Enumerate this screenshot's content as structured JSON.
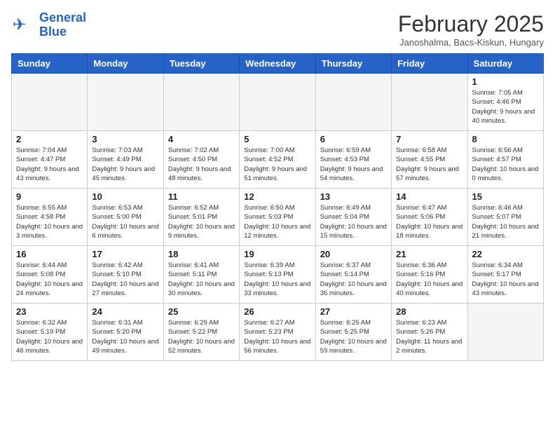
{
  "header": {
    "logo_line1": "General",
    "logo_line2": "Blue",
    "month": "February 2025",
    "location": "Janoshalma, Bacs-Kiskun, Hungary"
  },
  "weekdays": [
    "Sunday",
    "Monday",
    "Tuesday",
    "Wednesday",
    "Thursday",
    "Friday",
    "Saturday"
  ],
  "weeks": [
    [
      {
        "day": "",
        "info": ""
      },
      {
        "day": "",
        "info": ""
      },
      {
        "day": "",
        "info": ""
      },
      {
        "day": "",
        "info": ""
      },
      {
        "day": "",
        "info": ""
      },
      {
        "day": "",
        "info": ""
      },
      {
        "day": "1",
        "info": "Sunrise: 7:05 AM\nSunset: 4:46 PM\nDaylight: 9 hours and 40 minutes."
      }
    ],
    [
      {
        "day": "2",
        "info": "Sunrise: 7:04 AM\nSunset: 4:47 PM\nDaylight: 9 hours and 43 minutes."
      },
      {
        "day": "3",
        "info": "Sunrise: 7:03 AM\nSunset: 4:49 PM\nDaylight: 9 hours and 45 minutes."
      },
      {
        "day": "4",
        "info": "Sunrise: 7:02 AM\nSunset: 4:50 PM\nDaylight: 9 hours and 48 minutes."
      },
      {
        "day": "5",
        "info": "Sunrise: 7:00 AM\nSunset: 4:52 PM\nDaylight: 9 hours and 51 minutes."
      },
      {
        "day": "6",
        "info": "Sunrise: 6:59 AM\nSunset: 4:53 PM\nDaylight: 9 hours and 54 minutes."
      },
      {
        "day": "7",
        "info": "Sunrise: 6:58 AM\nSunset: 4:55 PM\nDaylight: 9 hours and 57 minutes."
      },
      {
        "day": "8",
        "info": "Sunrise: 6:56 AM\nSunset: 4:57 PM\nDaylight: 10 hours and 0 minutes."
      }
    ],
    [
      {
        "day": "9",
        "info": "Sunrise: 6:55 AM\nSunset: 4:58 PM\nDaylight: 10 hours and 3 minutes."
      },
      {
        "day": "10",
        "info": "Sunrise: 6:53 AM\nSunset: 5:00 PM\nDaylight: 10 hours and 6 minutes."
      },
      {
        "day": "11",
        "info": "Sunrise: 6:52 AM\nSunset: 5:01 PM\nDaylight: 10 hours and 9 minutes."
      },
      {
        "day": "12",
        "info": "Sunrise: 6:50 AM\nSunset: 5:03 PM\nDaylight: 10 hours and 12 minutes."
      },
      {
        "day": "13",
        "info": "Sunrise: 6:49 AM\nSunset: 5:04 PM\nDaylight: 10 hours and 15 minutes."
      },
      {
        "day": "14",
        "info": "Sunrise: 6:47 AM\nSunset: 5:06 PM\nDaylight: 10 hours and 18 minutes."
      },
      {
        "day": "15",
        "info": "Sunrise: 6:46 AM\nSunset: 5:07 PM\nDaylight: 10 hours and 21 minutes."
      }
    ],
    [
      {
        "day": "16",
        "info": "Sunrise: 6:44 AM\nSunset: 5:08 PM\nDaylight: 10 hours and 24 minutes."
      },
      {
        "day": "17",
        "info": "Sunrise: 6:42 AM\nSunset: 5:10 PM\nDaylight: 10 hours and 27 minutes."
      },
      {
        "day": "18",
        "info": "Sunrise: 6:41 AM\nSunset: 5:11 PM\nDaylight: 10 hours and 30 minutes."
      },
      {
        "day": "19",
        "info": "Sunrise: 6:39 AM\nSunset: 5:13 PM\nDaylight: 10 hours and 33 minutes."
      },
      {
        "day": "20",
        "info": "Sunrise: 6:37 AM\nSunset: 5:14 PM\nDaylight: 10 hours and 36 minutes."
      },
      {
        "day": "21",
        "info": "Sunrise: 6:36 AM\nSunset: 5:16 PM\nDaylight: 10 hours and 40 minutes."
      },
      {
        "day": "22",
        "info": "Sunrise: 6:34 AM\nSunset: 5:17 PM\nDaylight: 10 hours and 43 minutes."
      }
    ],
    [
      {
        "day": "23",
        "info": "Sunrise: 6:32 AM\nSunset: 5:19 PM\nDaylight: 10 hours and 46 minutes."
      },
      {
        "day": "24",
        "info": "Sunrise: 6:31 AM\nSunset: 5:20 PM\nDaylight: 10 hours and 49 minutes."
      },
      {
        "day": "25",
        "info": "Sunrise: 6:29 AM\nSunset: 5:22 PM\nDaylight: 10 hours and 52 minutes."
      },
      {
        "day": "26",
        "info": "Sunrise: 6:27 AM\nSunset: 5:23 PM\nDaylight: 10 hours and 56 minutes."
      },
      {
        "day": "27",
        "info": "Sunrise: 6:25 AM\nSunset: 5:25 PM\nDaylight: 10 hours and 59 minutes."
      },
      {
        "day": "28",
        "info": "Sunrise: 6:23 AM\nSunset: 5:26 PM\nDaylight: 11 hours and 2 minutes."
      },
      {
        "day": "",
        "info": ""
      }
    ]
  ]
}
